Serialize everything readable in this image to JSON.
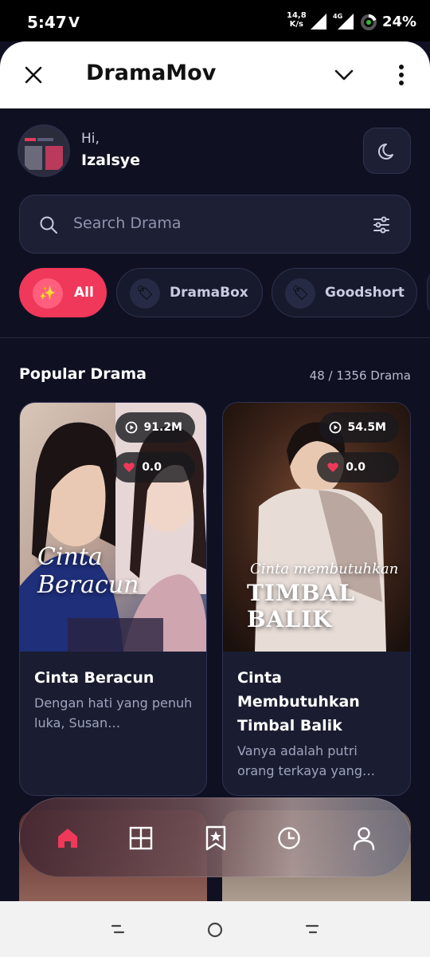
{
  "status_bar": {
    "time": "5:47",
    "net_speed_value": "14,8",
    "net_speed_unit": "K/s",
    "network": "4G",
    "battery": "24%"
  },
  "browser": {
    "title": "DramaMov"
  },
  "user": {
    "greeting": "Hi,",
    "name": "Izalsye"
  },
  "search": {
    "placeholder": "Search Drama"
  },
  "chips": [
    {
      "label": "All",
      "icon": "sparkles-icon",
      "active": true
    },
    {
      "label": "DramaBox",
      "icon": "tag-icon",
      "active": false
    },
    {
      "label": "Goodshort",
      "icon": "tag-icon",
      "active": false
    }
  ],
  "section": {
    "title": "Popular Drama",
    "count": "48 / 1356 Drama"
  },
  "dramas": [
    {
      "title": "Cinta Beracun",
      "description": "Dengan hati yang penuh luka, Susan…",
      "views": "91.2M",
      "likes": "0.0",
      "poster_text": "Cinta Beracun"
    },
    {
      "title": "Cinta Membutuhkan Timbal Balik",
      "description": "Vanya adalah putri orang terkaya yang…",
      "views": "54.5M",
      "likes": "0.0",
      "poster_text_top": "Cinta membutuhkan",
      "poster_text_main": "TIMBAL BALIK"
    }
  ],
  "bottom_nav": {
    "items": [
      {
        "icon": "home-icon",
        "active": true
      },
      {
        "icon": "grid-icon",
        "active": false
      },
      {
        "icon": "bookmark-star-icon",
        "active": false
      },
      {
        "icon": "history-icon",
        "active": false
      },
      {
        "icon": "profile-icon",
        "active": false
      }
    ]
  },
  "colors": {
    "accent": "#f0385a",
    "background": "#0f1122",
    "card": "#1a1d31"
  }
}
